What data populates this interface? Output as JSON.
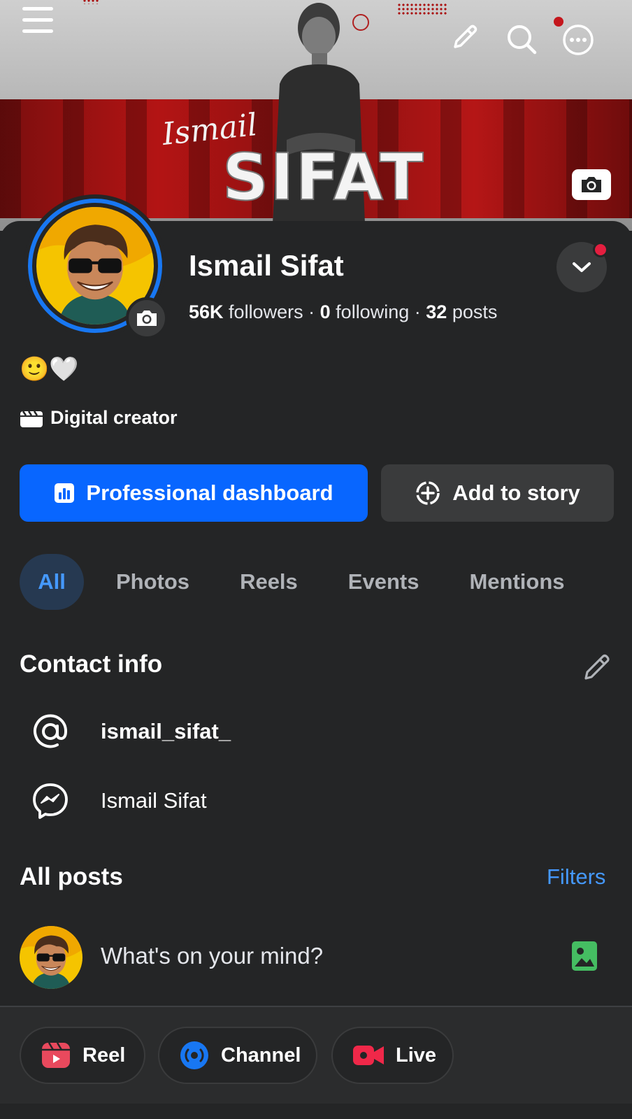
{
  "cover": {
    "script_text": "Ismail",
    "title_text": "SIFAT"
  },
  "profile": {
    "name": "Ismail Sifat",
    "followers_count": "56K",
    "followers_label": "followers",
    "following_count": "0",
    "following_label": "following",
    "posts_count": "32",
    "posts_label": "posts",
    "separator": "·",
    "bio": "🙂🤍",
    "category": "Digital creator"
  },
  "buttons": {
    "dashboard_label": "Professional dashboard",
    "story_label": "Add to story"
  },
  "tabs": [
    {
      "label": "All",
      "active": true
    },
    {
      "label": "Photos",
      "active": false
    },
    {
      "label": "Reels",
      "active": false
    },
    {
      "label": "Events",
      "active": false
    },
    {
      "label": "Mentions",
      "active": false
    }
  ],
  "contact": {
    "title": "Contact info",
    "instagram": "ismail_sifat_",
    "messenger": "Ismail Sifat"
  },
  "posts": {
    "title": "All posts",
    "filters_label": "Filters",
    "composer_placeholder": "What's on your mind?"
  },
  "actions": {
    "reel_label": "Reel",
    "channel_label": "Channel",
    "live_label": "Live"
  },
  "colors": {
    "accent": "#0866ff",
    "link": "#4599ff",
    "background": "#242526",
    "surface": "#3a3b3c",
    "notification": "#e41e3f"
  },
  "icons": [
    "menu-icon",
    "pencil-icon",
    "search-icon",
    "more-icon",
    "camera-icon",
    "chevron-down-icon",
    "clapperboard-icon",
    "dashboard-icon",
    "add-story-icon",
    "at-sign-icon",
    "messenger-icon",
    "photo-icon",
    "reel-icon",
    "channel-icon",
    "live-video-icon"
  ]
}
